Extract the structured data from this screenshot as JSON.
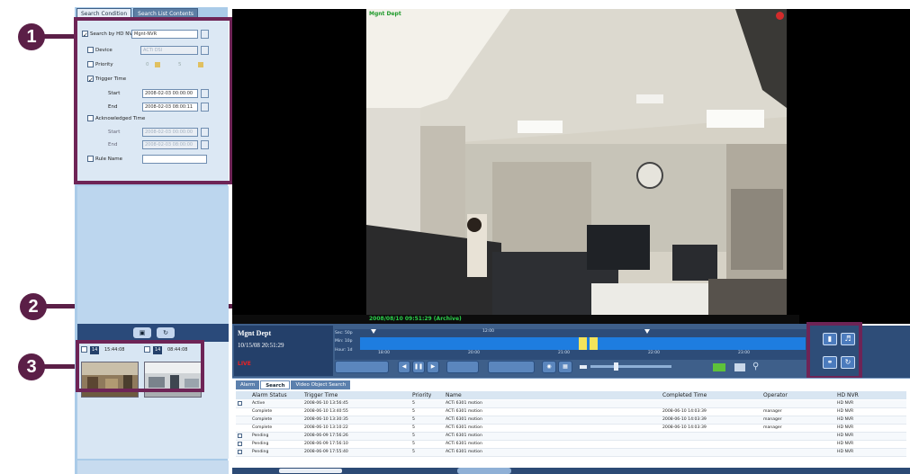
{
  "callouts": [
    "1",
    "2",
    "3"
  ],
  "search_tabs": [
    "Search Condition",
    "Search List Contents"
  ],
  "search": {
    "hd_nvr": {
      "label": "Search by HD NVR",
      "value": "Mgnt-NVR"
    },
    "device": {
      "label": "Device",
      "value": "ACTi DSI"
    },
    "priority": {
      "label": "Priority",
      "from": "0",
      "to": "5"
    },
    "trigger_time": {
      "label": "Trigger Time",
      "start_label": "Start",
      "start": "2008-02-03 00:00:00",
      "end_label": "End",
      "end": "2008-02-03 08:00:11"
    },
    "ack_time": {
      "label": "Acknowledged Time",
      "start_label": "Start",
      "start": "2008-02-03 00:00:00",
      "end_label": "End",
      "end": "2008-02-03 08:00:00"
    },
    "rule_name": {
      "label": "Rule Name",
      "value": ""
    }
  },
  "thumbnails": [
    {
      "id": "14",
      "time": "15:44:08"
    },
    {
      "id": "14",
      "time": "08:44:08"
    }
  ],
  "video": {
    "camera_title": "Mgnt Dept",
    "timestamp": "2008/08/10 09:51:29 (Archive)"
  },
  "playback": {
    "camera_name": "Mgnt Dept",
    "time": "10/15/08 20:51:29",
    "live": "LIVE",
    "rows": [
      "Sec: 50p",
      "Min: 10p",
      "Hour: 1d"
    ],
    "ticks": [
      "12:00",
      "18:00",
      "20:00",
      "21:00",
      "22:00",
      "23:00"
    ]
  },
  "list": {
    "tabs": [
      "Alarm",
      "Search",
      "Video Object Search"
    ],
    "columns": [
      "Alarm Status",
      "Trigger Time",
      "Priority",
      "Name",
      "Completed Time",
      "Operator",
      "HD NVR"
    ],
    "rows": [
      {
        "status": "Active",
        "trigger": "2008-06-10 13:56:45",
        "priority": "5",
        "name": "ACTi 6301 motion",
        "completed": "",
        "operator": "",
        "nvr": "HD NVR"
      },
      {
        "status": "Complete",
        "trigger": "2008-06-10 13:40:55",
        "priority": "5",
        "name": "ACTi 6301 motion",
        "completed": "2008-06-10 14:03:39",
        "operator": "manager",
        "nvr": "HD NVR"
      },
      {
        "status": "Complete",
        "trigger": "2008-06-10 13:30:35",
        "priority": "5",
        "name": "ACTi 6301 motion",
        "completed": "2008-06-10 14:03:39",
        "operator": "manager",
        "nvr": "HD NVR"
      },
      {
        "status": "Complete",
        "trigger": "2008-06-10 13:10:22",
        "priority": "5",
        "name": "ACTi 6301 motion",
        "completed": "2008-06-10 14:03:39",
        "operator": "manager",
        "nvr": "HD NVR"
      },
      {
        "status": "Pending",
        "trigger": "2008-06-09 17:56:26",
        "priority": "5",
        "name": "ACTi 6301 motion",
        "completed": "",
        "operator": "",
        "nvr": "HD NVR"
      },
      {
        "status": "Pending",
        "trigger": "2008-06-09 17:56:10",
        "priority": "5",
        "name": "ACTi 6301 motion",
        "completed": "",
        "operator": "",
        "nvr": "HD NVR"
      },
      {
        "status": "Pending",
        "trigger": "2008-06-09 17:55:40",
        "priority": "5",
        "name": "ACTi 6301 motion",
        "completed": "",
        "operator": "",
        "nvr": "HD NVR"
      }
    ]
  },
  "colors": {
    "callout": "#5b1f47",
    "panel": "#aacbe8",
    "timeline": "#1e7de0"
  }
}
